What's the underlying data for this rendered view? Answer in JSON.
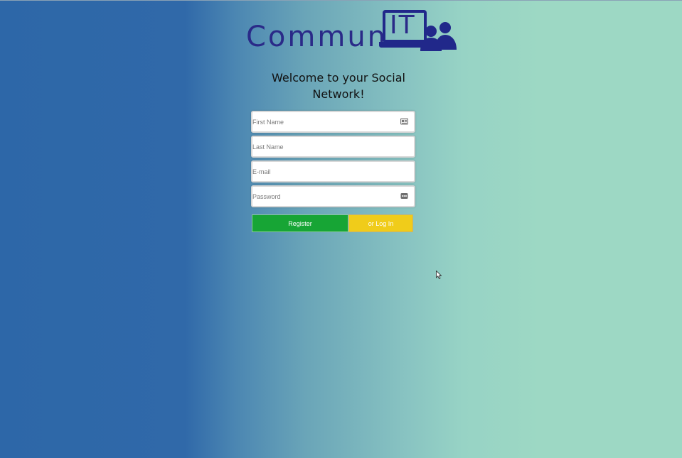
{
  "logo": {
    "text_main": "Commun",
    "text_it": "IT",
    "icon": "monitor-people-logo"
  },
  "welcome": {
    "line1": "Welcome to your Social",
    "line2": "Network!"
  },
  "form": {
    "first_name": {
      "placeholder": "First Name",
      "value": "",
      "icon": "id-card-icon"
    },
    "last_name": {
      "placeholder": "Last Name",
      "value": ""
    },
    "email": {
      "placeholder": "E-mail",
      "value": ""
    },
    "password": {
      "placeholder": "Password",
      "value": "",
      "icon": "password-dots-icon"
    }
  },
  "buttons": {
    "register_label": "Register",
    "login_label": "or Log In"
  },
  "colors": {
    "bg_left": "#2d67a8",
    "bg_right": "#9dd8c4",
    "logo": "#2a2a88",
    "register": "#17a535",
    "login": "#f0cc1a"
  }
}
